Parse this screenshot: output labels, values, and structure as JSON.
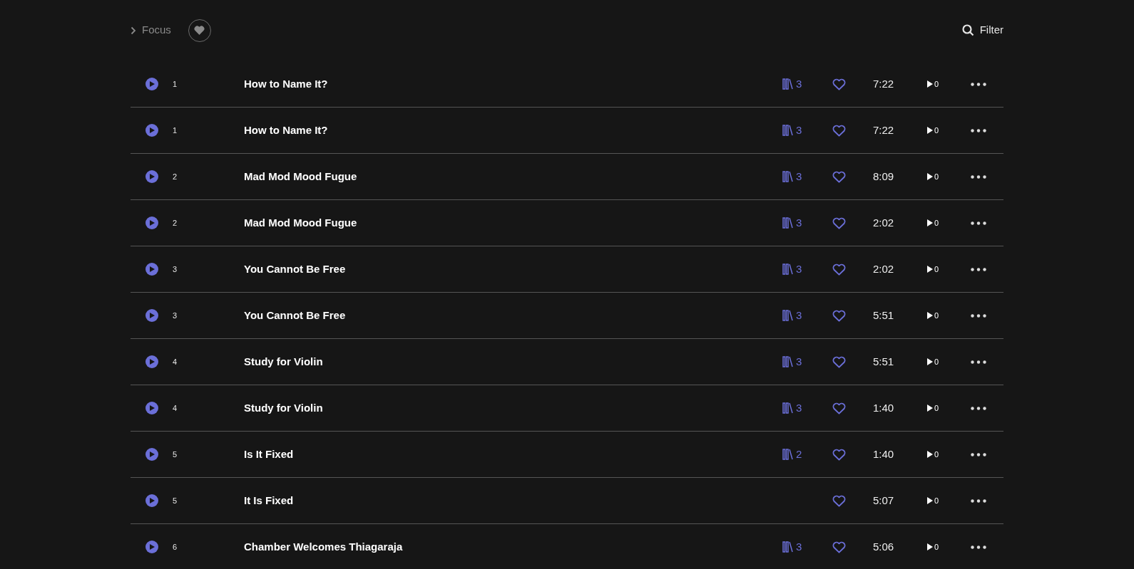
{
  "header": {
    "focus_label": "Focus",
    "filter_label": "Filter"
  },
  "tracks": [
    {
      "number": "1",
      "title": "How to Name It?",
      "library_count": "3",
      "duration": "7:22",
      "plays": "0"
    },
    {
      "number": "1",
      "title": "How to Name It?",
      "library_count": "3",
      "duration": "7:22",
      "plays": "0"
    },
    {
      "number": "2",
      "title": "Mad Mod Mood Fugue",
      "library_count": "3",
      "duration": "8:09",
      "plays": "0"
    },
    {
      "number": "2",
      "title": "Mad Mod Mood Fugue",
      "library_count": "3",
      "duration": "2:02",
      "plays": "0"
    },
    {
      "number": "3",
      "title": "You Cannot Be Free",
      "library_count": "3",
      "duration": "2:02",
      "plays": "0"
    },
    {
      "number": "3",
      "title": "You Cannot Be Free",
      "library_count": "3",
      "duration": "5:51",
      "plays": "0"
    },
    {
      "number": "4",
      "title": "Study for Violin",
      "library_count": "3",
      "duration": "5:51",
      "plays": "0"
    },
    {
      "number": "4",
      "title": "Study for Violin",
      "library_count": "3",
      "duration": "1:40",
      "plays": "0"
    },
    {
      "number": "5",
      "title": "Is It Fixed",
      "library_count": "2",
      "duration": "1:40",
      "plays": "0"
    },
    {
      "number": "5",
      "title": "It Is Fixed",
      "duration": "5:07",
      "plays": "0"
    },
    {
      "number": "6",
      "title": "Chamber Welcomes Thiagaraja",
      "library_count": "3",
      "duration": "5:06",
      "plays": "0"
    }
  ]
}
